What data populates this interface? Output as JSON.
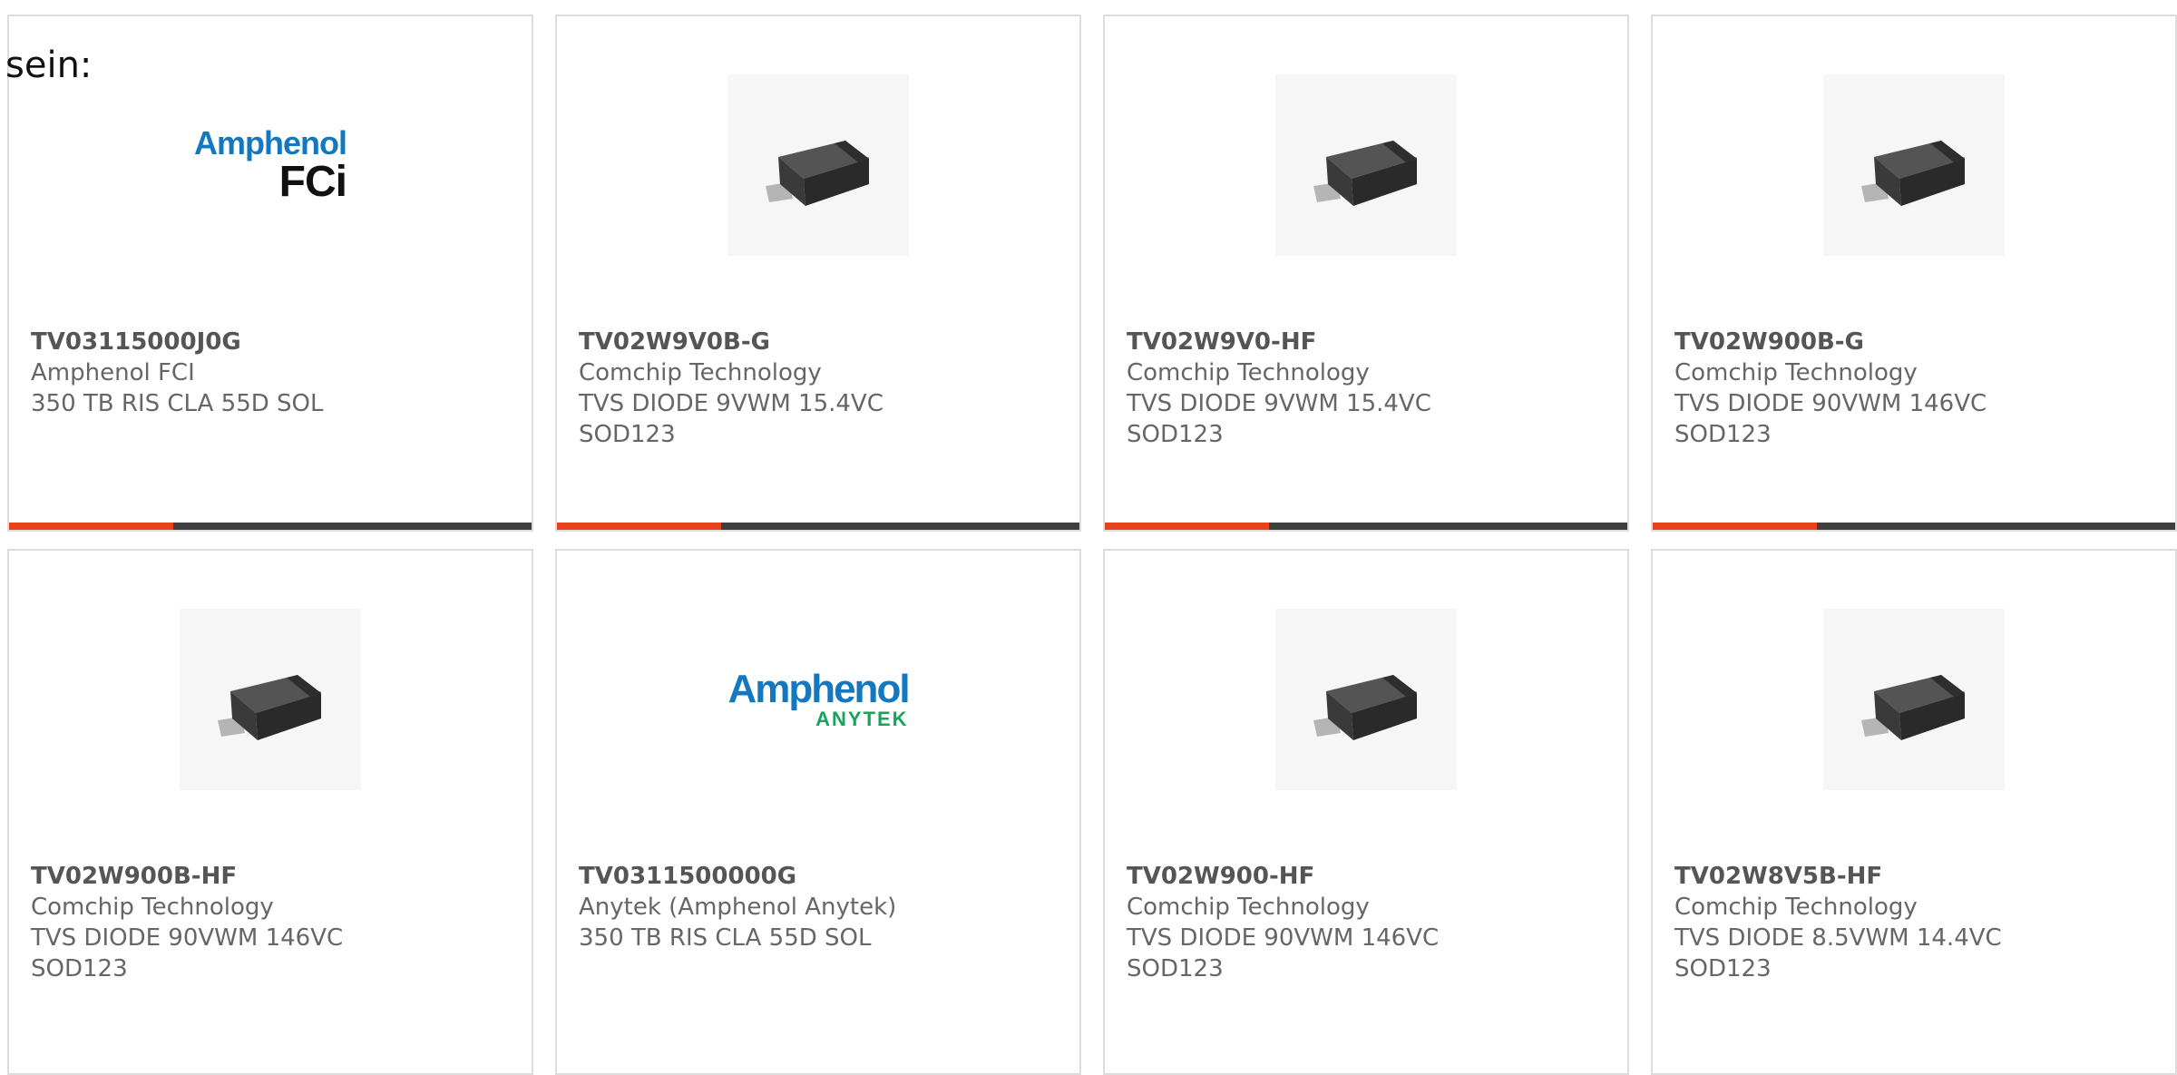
{
  "intro_text": "sein:",
  "accent_color": "#e8421c",
  "bar_color": "#3f3f3f",
  "cards": [
    {
      "part_number": "TV03115000J0G",
      "manufacturer": "Amphenol FCI",
      "desc_line1": "350 TB RIS CLA 55D SOL",
      "desc_line2": "",
      "image": "amphenol-fci-logo",
      "logo_text1": "Amphenol",
      "logo_text2": "FCi"
    },
    {
      "part_number": "TV02W9V0B-G",
      "manufacturer": "Comchip Technology",
      "desc_line1": "TVS DIODE 9VWM 15.4VC",
      "desc_line2": "SOD123",
      "image": "sod123-diode-package"
    },
    {
      "part_number": "TV02W9V0-HF",
      "manufacturer": "Comchip Technology",
      "desc_line1": "TVS DIODE 9VWM 15.4VC",
      "desc_line2": "SOD123",
      "image": "sod123-diode-package"
    },
    {
      "part_number": "TV02W900B-G",
      "manufacturer": "Comchip Technology",
      "desc_line1": "TVS DIODE 90VWM 146VC",
      "desc_line2": "SOD123",
      "image": "sod123-diode-package"
    },
    {
      "part_number": "TV02W900B-HF",
      "manufacturer": "Comchip Technology",
      "desc_line1": "TVS DIODE 90VWM 146VC",
      "desc_line2": "SOD123",
      "image": "sod123-diode-package"
    },
    {
      "part_number": "TV0311500000G",
      "manufacturer": "Anytek (Amphenol Anytek)",
      "desc_line1": "350 TB RIS CLA 55D SOL",
      "desc_line2": "",
      "image": "amphenol-anytek-logo",
      "logo_text1": "Amphenol",
      "logo_text2": "ANYTEK"
    },
    {
      "part_number": "TV02W900-HF",
      "manufacturer": "Comchip Technology",
      "desc_line1": "TVS DIODE 90VWM 146VC",
      "desc_line2": "SOD123",
      "image": "sod123-diode-package"
    },
    {
      "part_number": "TV02W8V5B-HF",
      "manufacturer": "Comchip Technology",
      "desc_line1": "TVS DIODE 8.5VWM 14.4VC",
      "desc_line2": "SOD123",
      "image": "sod123-diode-package"
    }
  ]
}
